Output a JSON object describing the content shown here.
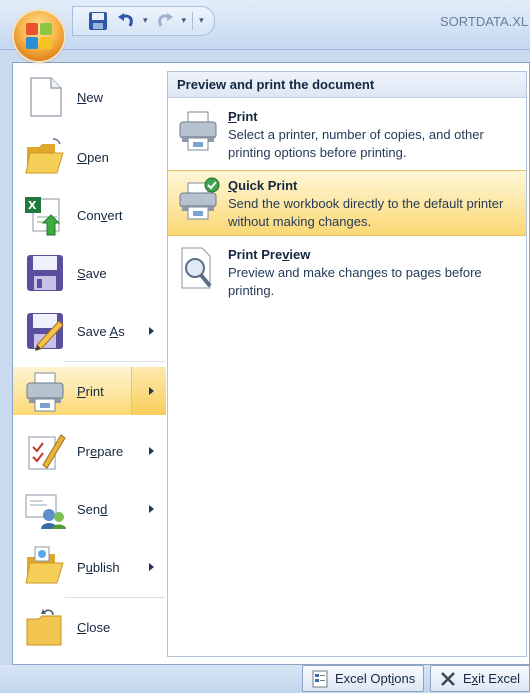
{
  "window": {
    "document_title": "SORTDATA.XL"
  },
  "left_menu": {
    "items": [
      {
        "pre": "",
        "key": "N",
        "post": "ew",
        "icon": "new-document-icon",
        "submenu": false
      },
      {
        "pre": "",
        "key": "O",
        "post": "pen",
        "icon": "open-folder-icon",
        "submenu": false
      },
      {
        "pre": "Con",
        "key": "v",
        "post": "ert",
        "icon": "convert-icon",
        "submenu": false
      },
      {
        "pre": "",
        "key": "S",
        "post": "ave",
        "icon": "save-disk-icon",
        "submenu": false
      },
      {
        "pre": "Save ",
        "key": "A",
        "post": "s",
        "icon": "save-as-icon",
        "submenu": true
      },
      {
        "pre": "",
        "key": "P",
        "post": "rint",
        "icon": "printer-icon",
        "submenu": true,
        "selected": true
      },
      {
        "pre": "Pr",
        "key": "e",
        "post": "pare",
        "icon": "prepare-icon",
        "submenu": true
      },
      {
        "pre": "Sen",
        "key": "d",
        "post": "",
        "icon": "send-icon",
        "submenu": true
      },
      {
        "pre": "P",
        "key": "u",
        "post": "blish",
        "icon": "publish-folder-icon",
        "submenu": true
      },
      {
        "pre": "",
        "key": "C",
        "post": "lose",
        "icon": "close-folder-icon",
        "submenu": false
      }
    ]
  },
  "print_panel": {
    "header": "Preview and print the document",
    "items": [
      {
        "pre": "",
        "key": "P",
        "post": "rint",
        "description": "Select a printer, number of copies, and other printing options before printing.",
        "icon": "printer-icon"
      },
      {
        "pre": "",
        "key": "Q",
        "post": "uick Print",
        "description": "Send the workbook directly to the default printer without making changes.",
        "icon": "quick-print-icon",
        "highlighted": true
      },
      {
        "pre": "Print Pre",
        "key": "v",
        "post": "iew",
        "description": "Preview and make changes to pages before printing.",
        "icon": "print-preview-icon"
      }
    ]
  },
  "footer": {
    "excel_options": {
      "pre": "Excel Opt",
      "key": "i",
      "post": "ons"
    },
    "exit_excel": {
      "pre": "E",
      "key": "x",
      "post": "it Excel"
    }
  },
  "colors": {
    "accent_hover": "#fde9ac",
    "frame_border": "#8ca4c6",
    "ribbon_blue": "#c9d9ee"
  }
}
